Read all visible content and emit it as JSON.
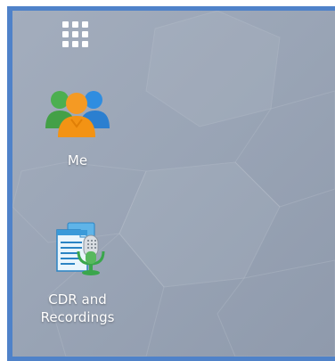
{
  "desktop": {
    "launcher_icon": "apps-grid-icon",
    "apps": [
      {
        "label": "Me",
        "icon": "users-icon"
      },
      {
        "label": "CDR and\nRecordings",
        "label_line1": "CDR and",
        "label_line2": "Recordings",
        "icon": "cdr-recordings-icon"
      }
    ]
  },
  "colors": {
    "frame": "#4f82c9",
    "background": "#9aa5b6"
  }
}
